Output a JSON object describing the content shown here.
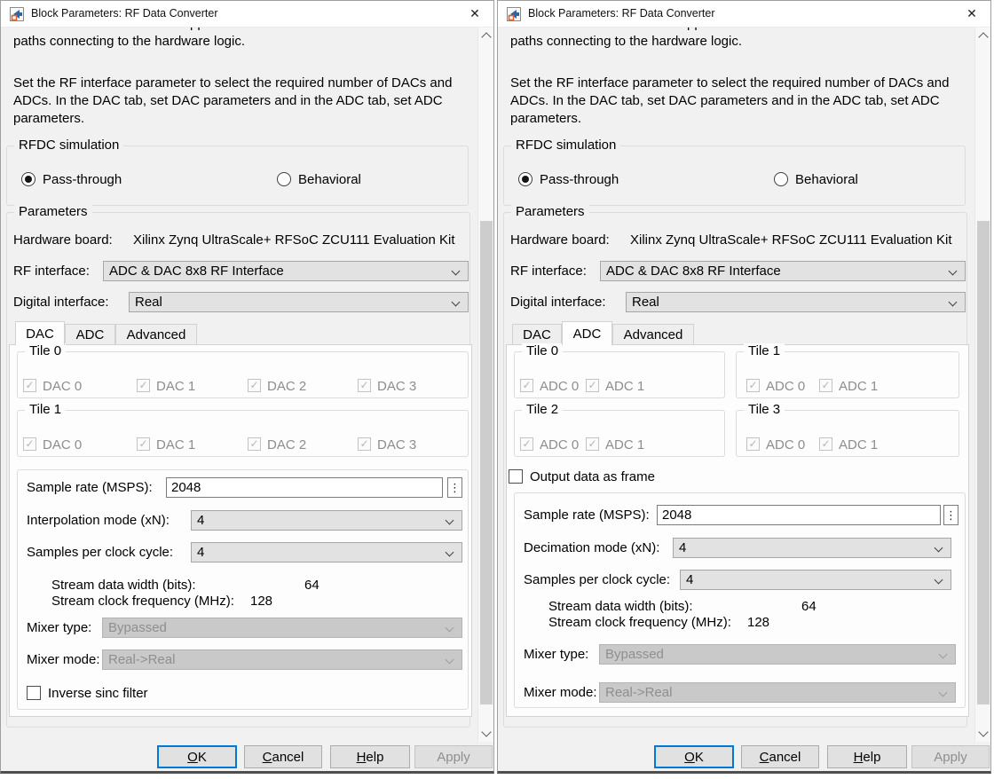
{
  "icons": {
    "close": "✕",
    "ellipsis": "⋮",
    "check": "✓"
  },
  "windows": {
    "left": {
      "title": "Block Parameters: RF Data Converter",
      "description": {
        "fragment": "pp",
        "line1": "paths connecting to the hardware logic.",
        "body": "Set the RF interface parameter to select the required number of DACs and ADCs. In the DAC tab, set DAC parameters and in the ADC tab, set ADC parameters."
      },
      "rfdc": {
        "label": "RFDC simulation",
        "options": [
          {
            "label": "Pass-through",
            "selected": true
          },
          {
            "label": "Behavioral",
            "selected": false
          }
        ]
      },
      "params": {
        "label": "Parameters",
        "hardware_board_label": "Hardware board:",
        "hardware_board_value": "Xilinx Zynq UltraScale+ RFSoC ZCU111 Evaluation Kit",
        "rf_interface_label": "RF interface:",
        "rf_interface_value": "ADC & DAC 8x8 RF Interface",
        "digital_interface_label": "Digital interface:",
        "digital_interface_value": "Real"
      },
      "tabs": [
        {
          "label": "DAC",
          "selected": true
        },
        {
          "label": "ADC",
          "selected": false
        },
        {
          "label": "Advanced",
          "selected": false
        }
      ],
      "tiles": [
        {
          "label": "Tile 0",
          "channels": [
            "DAC 0",
            "DAC 1",
            "DAC 2",
            "DAC 3"
          ]
        },
        {
          "label": "Tile 1",
          "channels": [
            "DAC 0",
            "DAC 1",
            "DAC 2",
            "DAC 3"
          ]
        }
      ],
      "fields": {
        "sample_rate_label": "Sample rate (MSPS):",
        "sample_rate_value": "2048",
        "mode_label": "Interpolation mode (xN):",
        "mode_value": "4",
        "samples_per_clock_label": "Samples per clock cycle:",
        "samples_per_clock_value": "4",
        "stream_width_label": "Stream data width (bits):",
        "stream_width_value": "64",
        "stream_clock_label": "Stream clock frequency (MHz):",
        "stream_clock_value": "128",
        "mixer_type_label": "Mixer type:",
        "mixer_type_value": "Bypassed",
        "mixer_mode_label": "Mixer mode:",
        "mixer_mode_value": "Real->Real",
        "inverse_sinc_label": "Inverse sinc filter"
      },
      "buttons": {
        "ok_key": "O",
        "ok_rest": "K",
        "cancel_key": "C",
        "cancel_rest": "ancel",
        "help_key": "H",
        "help_rest": "elp",
        "apply": "Apply"
      }
    },
    "right": {
      "title": "Block Parameters: RF Data Converter",
      "description": {
        "fragment": "pp",
        "line1": "paths connecting to the hardware logic.",
        "body": "Set the RF interface parameter to select the required number of DACs and ADCs. In the DAC tab, set DAC parameters and in the ADC tab, set ADC parameters."
      },
      "rfdc": {
        "label": "RFDC simulation",
        "options": [
          {
            "label": "Pass-through",
            "selected": true
          },
          {
            "label": "Behavioral",
            "selected": false
          }
        ]
      },
      "params": {
        "label": "Parameters",
        "hardware_board_label": "Hardware board:",
        "hardware_board_value": "Xilinx Zynq UltraScale+ RFSoC ZCU111 Evaluation Kit",
        "rf_interface_label": "RF interface:",
        "rf_interface_value": "ADC & DAC 8x8 RF Interface",
        "digital_interface_label": "Digital interface:",
        "digital_interface_value": "Real"
      },
      "tabs": [
        {
          "label": "DAC",
          "selected": false
        },
        {
          "label": "ADC",
          "selected": true
        },
        {
          "label": "Advanced",
          "selected": false
        }
      ],
      "tiles": [
        {
          "label": "Tile 0",
          "channels": [
            "ADC 0",
            "ADC 1"
          ]
        },
        {
          "label": "Tile 1",
          "channels": [
            "ADC 0",
            "ADC 1"
          ]
        },
        {
          "label": "Tile 2",
          "channels": [
            "ADC 0",
            "ADC 1"
          ]
        },
        {
          "label": "Tile 3",
          "channels": [
            "ADC 0",
            "ADC 1"
          ]
        }
      ],
      "frame_label": "Output data as frame",
      "fields": {
        "sample_rate_label": "Sample rate (MSPS):",
        "sample_rate_value": "2048",
        "mode_label": "Decimation mode (xN):",
        "mode_value": "4",
        "samples_per_clock_label": "Samples per clock cycle:",
        "samples_per_clock_value": "4",
        "stream_width_label": "Stream data width (bits):",
        "stream_width_value": "64",
        "stream_clock_label": "Stream clock frequency (MHz):",
        "stream_clock_value": "128",
        "mixer_type_label": "Mixer type:",
        "mixer_type_value": "Bypassed",
        "mixer_mode_label": "Mixer mode:",
        "mixer_mode_value": "Real->Real"
      },
      "buttons": {
        "ok_key": "O",
        "ok_rest": "K",
        "cancel_key": "C",
        "cancel_rest": "ancel",
        "help_key": "H",
        "help_rest": "elp",
        "apply": "Apply"
      }
    }
  }
}
